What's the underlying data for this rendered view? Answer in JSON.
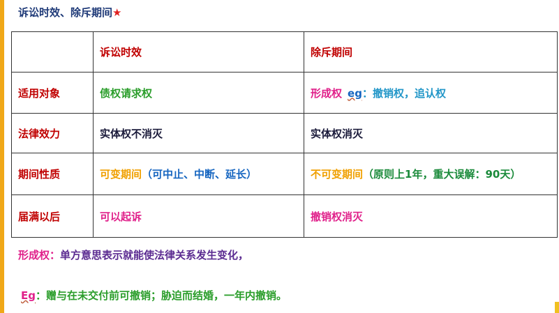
{
  "title": {
    "text": "诉讼时效、除斥期间",
    "star": "★"
  },
  "table": {
    "header": [
      "",
      "诉讼时效",
      "除斥期间"
    ],
    "rows": [
      {
        "label": "适用对象",
        "col1": "债权请求权",
        "col2_main": "形成权",
        "col2_eg": "eg",
        "col2_rest": "：撤销权，追认权"
      },
      {
        "label": "法律效力",
        "col1": "实体权不消灭",
        "col2": "实体权消灭"
      },
      {
        "label": "期间性质",
        "col1_main": "可变期间",
        "col1_note": "（可中止、中断、延长）",
        "col2_main": "不可变期间",
        "col2_note": "（原则上1年，重大误解：90天）"
      },
      {
        "label": "届满以后",
        "col1": "可以起诉",
        "col2": "撤销权消灭"
      }
    ]
  },
  "notes": {
    "line1_label": "形成权：",
    "line1_text": "单方意思表示就能使法律关系发生变化，",
    "line2_label": "Eg",
    "line2_text": "：赠与在未交付前可撤销；胁迫而结婚，一年内撤销。"
  },
  "colors": {
    "accent_bar": "#f0a818",
    "title": "#1f3a78",
    "row_label": "#c00000",
    "magenta": "#e0208a",
    "green": "#2a9d2a",
    "orange": "#f0a000",
    "blue": "#1565c0"
  }
}
